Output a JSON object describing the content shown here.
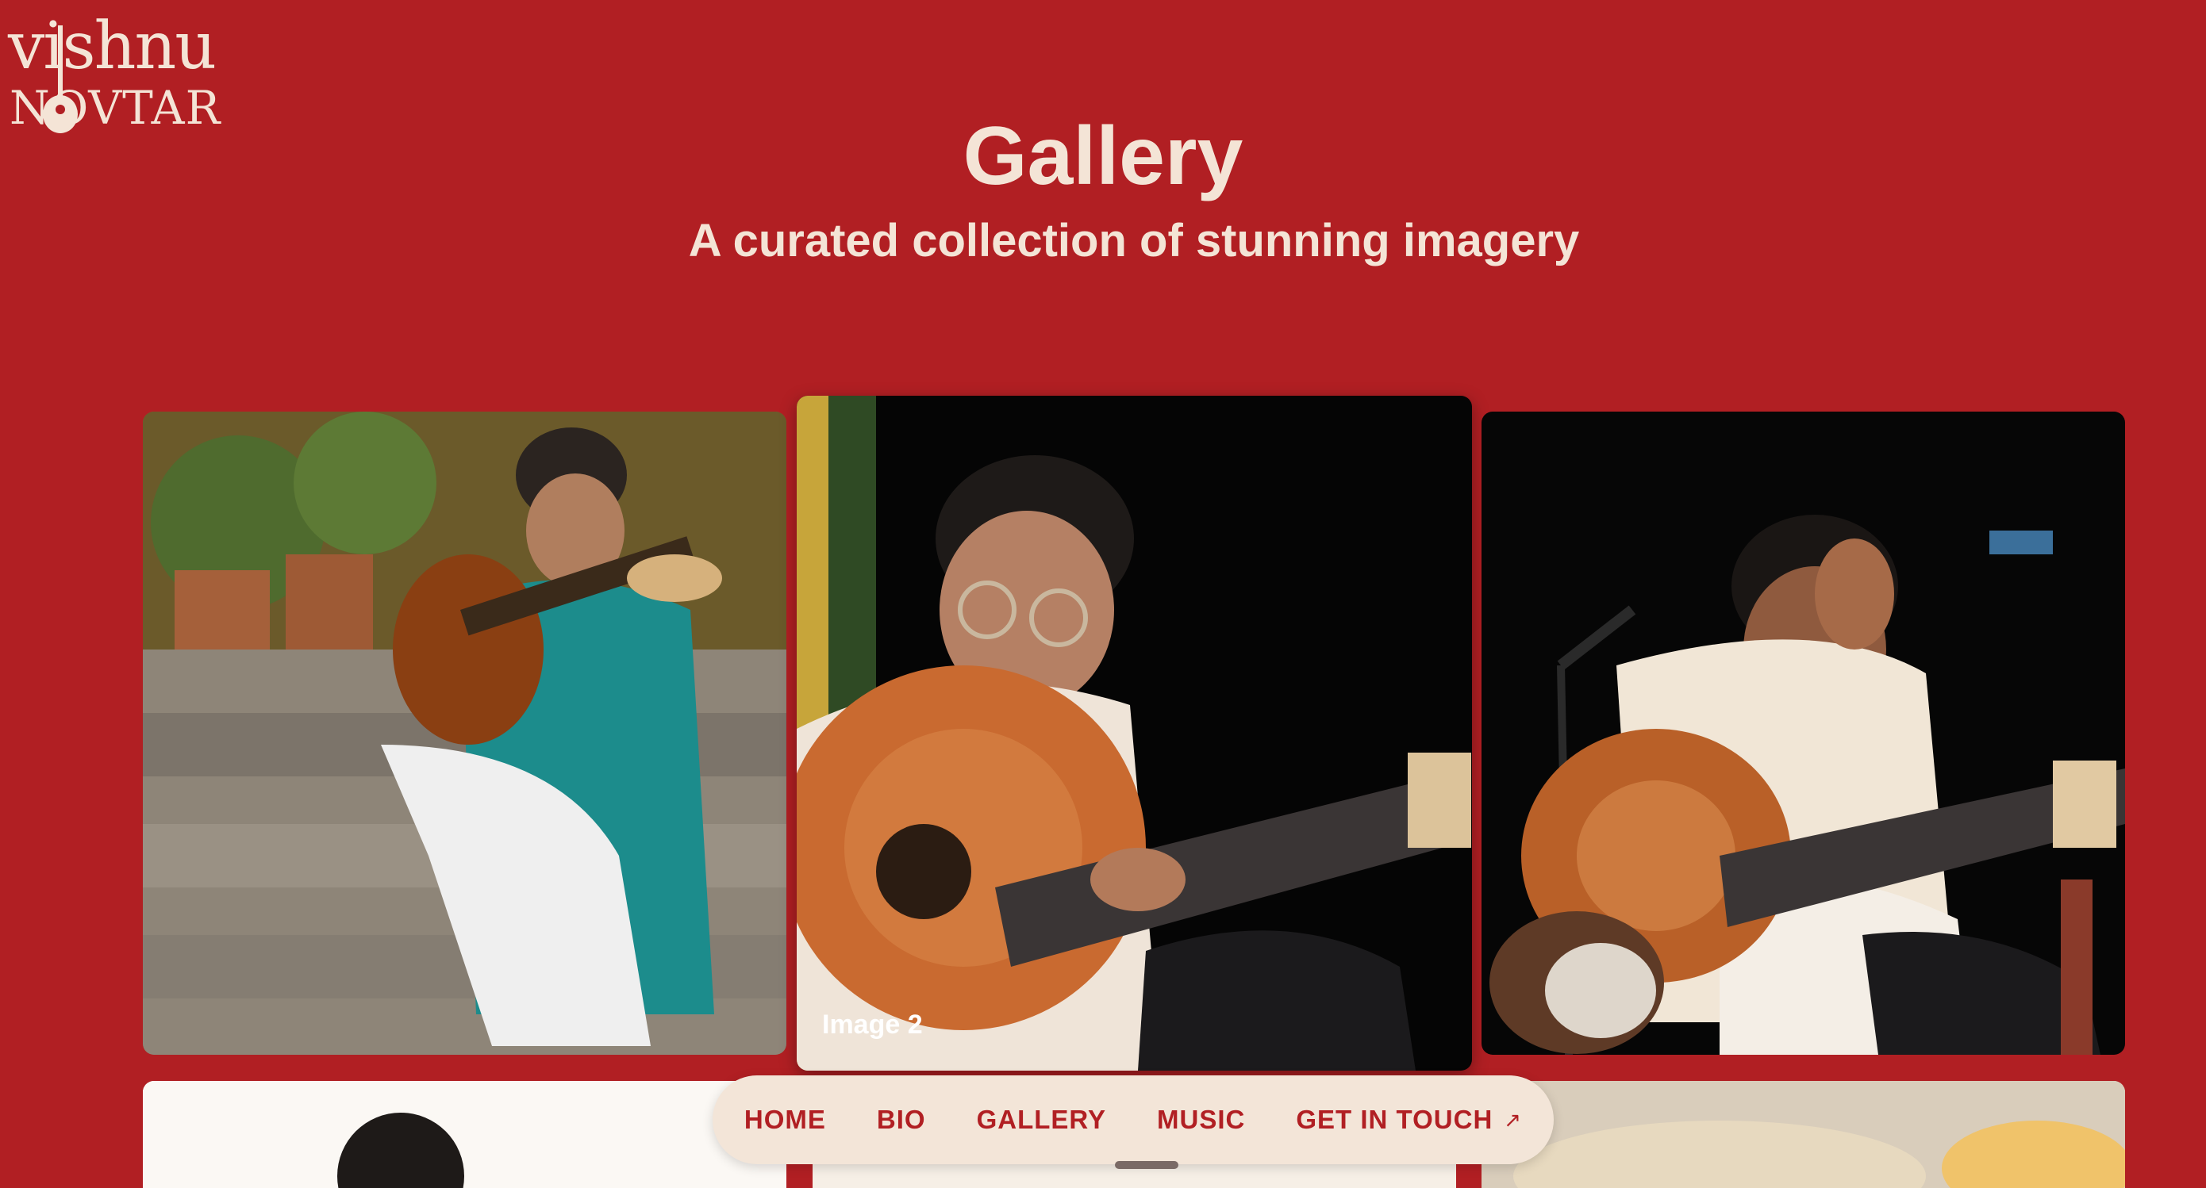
{
  "brand": {
    "logo_top": "vishnu",
    "logo_bottom": "NOVTAR"
  },
  "header": {
    "title": "Gallery",
    "subtitle": "A curated collection of stunning imagery"
  },
  "gallery": {
    "images": [
      {
        "alt": "Musician in teal kurta playing guitar on stone steps",
        "icon": "photo"
      },
      {
        "alt": "Musician playing multi-string guitar on dark stage",
        "caption": "Image 2",
        "icon": "photo"
      },
      {
        "alt": "Musician bowing with palms joined on stage",
        "icon": "photo"
      },
      {
        "alt": "Musician portrait on light background",
        "icon": "photo"
      },
      {
        "alt": "Musician partial portrait",
        "icon": "photo"
      },
      {
        "alt": "Outdoor sky scene",
        "icon": "photo"
      }
    ]
  },
  "nav": {
    "items": [
      {
        "label": "HOME"
      },
      {
        "label": "BIO"
      },
      {
        "label": "GALLERY"
      },
      {
        "label": "MUSIC"
      },
      {
        "label": "GET IN TOUCH"
      }
    ],
    "external_arrow": "↗"
  },
  "colors": {
    "background": "#b11f23",
    "cream": "#f4e4d6",
    "nav_bg": "#f3e5d8"
  }
}
